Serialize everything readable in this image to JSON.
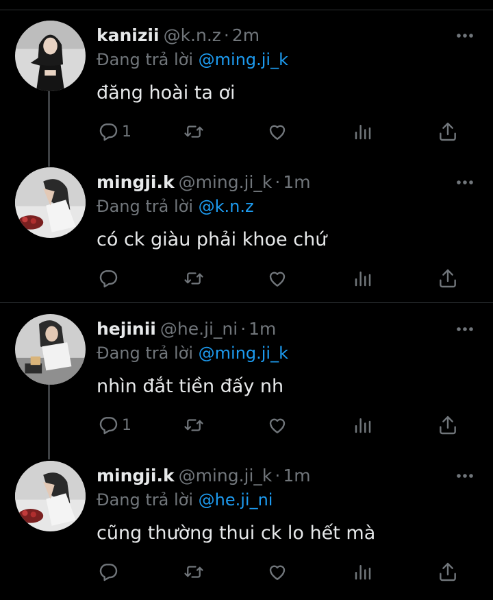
{
  "reply_prefix": "Đang trả lời ",
  "thread_a": {
    "parent": {
      "display_name": "kanizii",
      "handle": "@k.n.z",
      "separator": "·",
      "time": "2m",
      "reply_to": "@ming.ji_k",
      "text": "đăng hoài ta ơi",
      "reply_count": "1",
      "avatar_icon": "avatar-kanizii"
    },
    "child": {
      "display_name": "mingji.k",
      "handle": "@ming.ji_k",
      "separator": "·",
      "time": "1m",
      "reply_to": "@k.n.z",
      "text": "có ck giàu phải khoe chứ",
      "reply_count": "",
      "avatar_icon": "avatar-mingji"
    }
  },
  "thread_b": {
    "parent": {
      "display_name": "hejinii",
      "handle": "@he.ji_ni",
      "separator": "·",
      "time": "1m",
      "reply_to": "@ming.ji_k",
      "text": "nhìn đắt tiền đấy nh",
      "reply_count": "1",
      "avatar_icon": "avatar-hejinii"
    },
    "child": {
      "display_name": "mingji.k",
      "handle": "@ming.ji_k",
      "separator": "·",
      "time": "1m",
      "reply_to": "@he.ji_ni",
      "text": "cũng thường thui ck lo hết mà",
      "reply_count": "",
      "avatar_icon": "avatar-mingji"
    }
  },
  "icons": [
    "reply-icon",
    "retweet-icon",
    "like-icon",
    "views-icon",
    "share-icon",
    "more-icon"
  ],
  "colors": {
    "background": "#000000",
    "text": "#e7e9ea",
    "muted": "#71767b",
    "link": "#1d9bf0",
    "divider": "#2f3336"
  }
}
